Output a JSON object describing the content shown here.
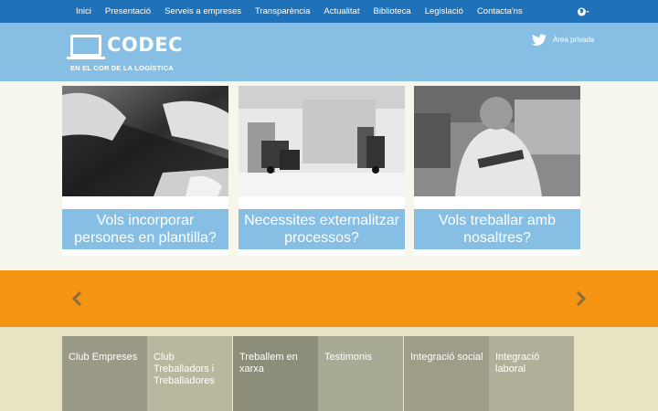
{
  "nav": {
    "items": [
      {
        "label": "Inici"
      },
      {
        "label": "Presentació"
      },
      {
        "label": "Serveis a empreses"
      },
      {
        "label": "Transparència"
      },
      {
        "label": "Actualitat"
      },
      {
        "label": "Biblioteca"
      },
      {
        "label": "Legislació"
      },
      {
        "label": "Contacta'ns"
      }
    ],
    "language_icon": "globe-icon"
  },
  "header": {
    "logo_name": "CODEC",
    "logo_tagline": "EN EL COR DE LA LOGÍSTICA",
    "social_icon": "twitter-icon",
    "private_area": "Àrea privada"
  },
  "cards": [
    {
      "caption": "Vols incorporar persones en plantilla?",
      "image": "hands-glass-photo"
    },
    {
      "caption": "Necessites externalitzar processos?",
      "image": "warehouse-forklift-photo"
    },
    {
      "caption": "Vols treballar amb nosaltres?",
      "image": "maintenance-worker-photo"
    }
  ],
  "slider": {
    "prev_icon": "chevron-left-icon",
    "next_icon": "chevron-right-icon"
  },
  "tiles": [
    {
      "label": "Club Empreses"
    },
    {
      "label": "Club Treballadors i Treballadores"
    },
    {
      "label": "Treballem en xarxa"
    },
    {
      "label": "Testimonis"
    },
    {
      "label": "Integració social"
    },
    {
      "label": "Integració laboral"
    }
  ],
  "colors": {
    "nav_bg": "#1f72b8",
    "header_bg": "#86bfe3",
    "slider_bg": "#f39513",
    "page_bg": "#f6f6ec",
    "tile_colors": [
      "#9a9a86",
      "#b8b89f",
      "#8d8e7a",
      "#a9aa93",
      "#9d9d88",
      "#b0b09a"
    ]
  }
}
